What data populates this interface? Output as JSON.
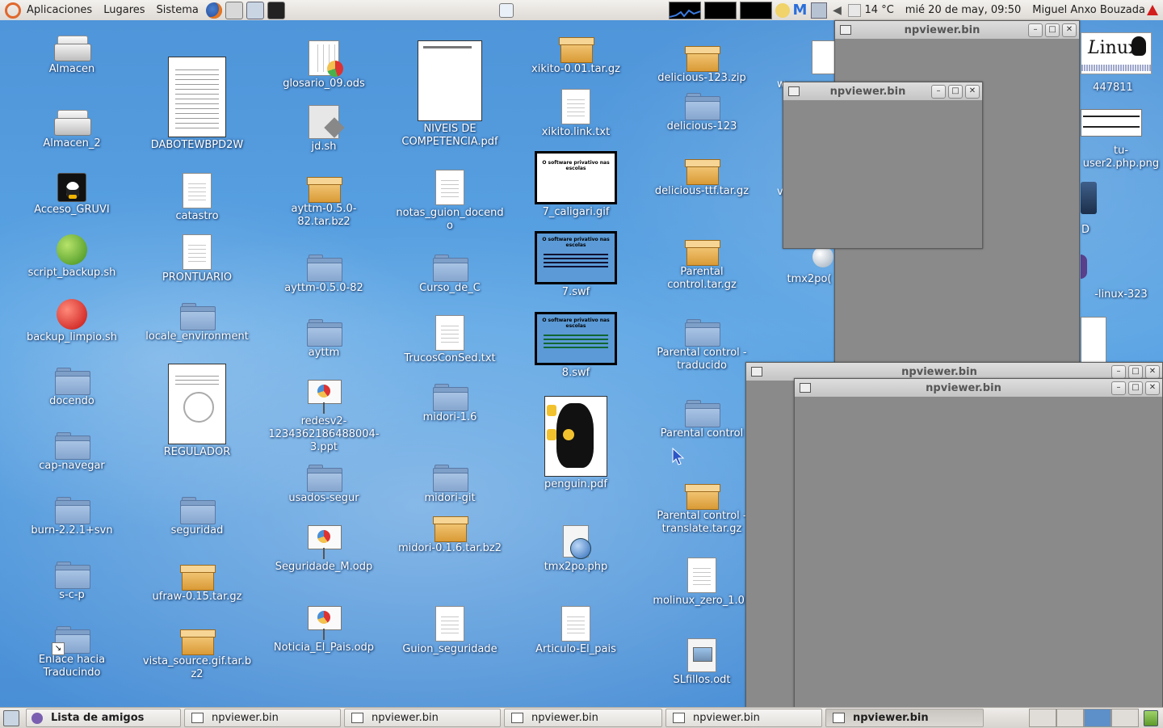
{
  "top_panel": {
    "menus": [
      "Aplicaciones",
      "Lugares",
      "Sistema"
    ],
    "weather": "14 °C",
    "clock": "mié 20 de may, 09:50",
    "user": "Miguel Anxo Bouzada"
  },
  "desktop": {
    "icons": [
      {
        "label": "Almacen",
        "type": "drive"
      },
      {
        "label": "Almacen_2",
        "type": "drive"
      },
      {
        "label": "Acceso_GRUVI",
        "type": "terminal"
      },
      {
        "label": "script_backup.sh",
        "type": "green-apple"
      },
      {
        "label": "backup_limpio.sh",
        "type": "red-apple"
      },
      {
        "label": "docendo",
        "type": "folder"
      },
      {
        "label": "cap-navegar",
        "type": "folder"
      },
      {
        "label": "burn-2.2.1+svn",
        "type": "folder"
      },
      {
        "label": "s-c-p",
        "type": "folder"
      },
      {
        "label": "Enlace hacia Traducindo",
        "type": "folder-link"
      },
      {
        "label": "DABOTEWBPD2W",
        "type": "doc-thumbnail"
      },
      {
        "label": "catastro",
        "type": "text"
      },
      {
        "label": "PRONTUARIO",
        "type": "text"
      },
      {
        "label": "locale_environment",
        "type": "folder"
      },
      {
        "label": "REGULADOR",
        "type": "doc-thumbnail"
      },
      {
        "label": "seguridad",
        "type": "folder"
      },
      {
        "label": "ufraw-0.15.tar.gz",
        "type": "archive"
      },
      {
        "label": "vista_source.gif.tar.bz2",
        "type": "archive"
      },
      {
        "label": "glosario_09.ods",
        "type": "spreadsheet"
      },
      {
        "label": "jd.sh",
        "type": "script"
      },
      {
        "label": "ayttm-0.5.0-82.tar.bz2",
        "type": "archive"
      },
      {
        "label": "ayttm-0.5.0-82",
        "type": "folder"
      },
      {
        "label": "ayttm",
        "type": "folder"
      },
      {
        "label": "redesv2-1234362186488004-3.ppt",
        "type": "presentation"
      },
      {
        "label": "usados-segur",
        "type": "folder"
      },
      {
        "label": "Seguridade_M.odp",
        "type": "presentation"
      },
      {
        "label": "Noticia_El_Pais.odp",
        "type": "presentation"
      },
      {
        "label": "NIVEIS DE COMPETENCIA.pdf",
        "type": "pdf-thumbnail"
      },
      {
        "label": "notas_guion_docendo",
        "type": "text"
      },
      {
        "label": "Curso_de_C",
        "type": "folder"
      },
      {
        "label": "TrucosConSed.txt",
        "type": "text"
      },
      {
        "label": "midori-1.6",
        "type": "folder"
      },
      {
        "label": "midori-git",
        "type": "folder"
      },
      {
        "label": "midori-0.1.6.tar.bz2",
        "type": "archive"
      },
      {
        "label": "Guion_seguridade",
        "type": "text"
      },
      {
        "label": "xikito-0.01.tar.gz",
        "type": "archive"
      },
      {
        "label": "xikito.link.txt",
        "type": "text"
      },
      {
        "label": "7_caligari.gif",
        "type": "image-thumbnail"
      },
      {
        "label": "7.swf",
        "type": "image-thumbnail"
      },
      {
        "label": "8.swf",
        "type": "image-thumbnail"
      },
      {
        "label": "penguin.pdf",
        "type": "penguin-thumbnail"
      },
      {
        "label": "tmx2po.php",
        "type": "php-globe"
      },
      {
        "label": "Articulo-El_pais",
        "type": "text"
      },
      {
        "label": "delicious-123.zip",
        "type": "archive"
      },
      {
        "label": "delicious-123",
        "type": "folder"
      },
      {
        "label": "delicious-ttf.tar.gz",
        "type": "archive"
      },
      {
        "label": "Parental control.tar.gz",
        "type": "archive"
      },
      {
        "label": "Parental control - traducido",
        "type": "folder"
      },
      {
        "label": "Parental control",
        "type": "folder"
      },
      {
        "label": "Parental control - translate.tar.gz",
        "type": "archive"
      },
      {
        "label": "molinux_zero_1.0.i",
        "type": "text"
      },
      {
        "label": "SLfillos.odt",
        "type": "image"
      },
      {
        "label": "447811",
        "type": "linux-badge"
      },
      {
        "label": "tu-user2.php.png",
        "type": "ubuntu-badge"
      },
      {
        "label": "tmx2po(",
        "type": "php-globe"
      },
      {
        "label": "D",
        "type": "speaker"
      },
      {
        "label": "-linux-323",
        "type": "image"
      }
    ],
    "thumb_texts": {
      "caligari": "O software privativo nas escolas",
      "swf": "O software privativo nas escolas"
    },
    "partial_labels": {
      "w1": "w",
      "w2": "v"
    }
  },
  "windows": [
    {
      "title": "npviewer.bin"
    },
    {
      "title": "npviewer.bin"
    },
    {
      "title": "npviewer.bin"
    },
    {
      "title": "npviewer.bin"
    }
  ],
  "bottom_panel": {
    "tasks": [
      {
        "label": "Lista de amigos",
        "bold": true
      },
      {
        "label": "npviewer.bin"
      },
      {
        "label": "npviewer.bin"
      },
      {
        "label": "npviewer.bin"
      },
      {
        "label": "npviewer.bin"
      },
      {
        "label": "npviewer.bin",
        "active": true
      }
    ]
  },
  "colors": {
    "desktop": "#4f95d9",
    "window_body": "#8a8a8a",
    "panel": "#e4e1dd"
  }
}
